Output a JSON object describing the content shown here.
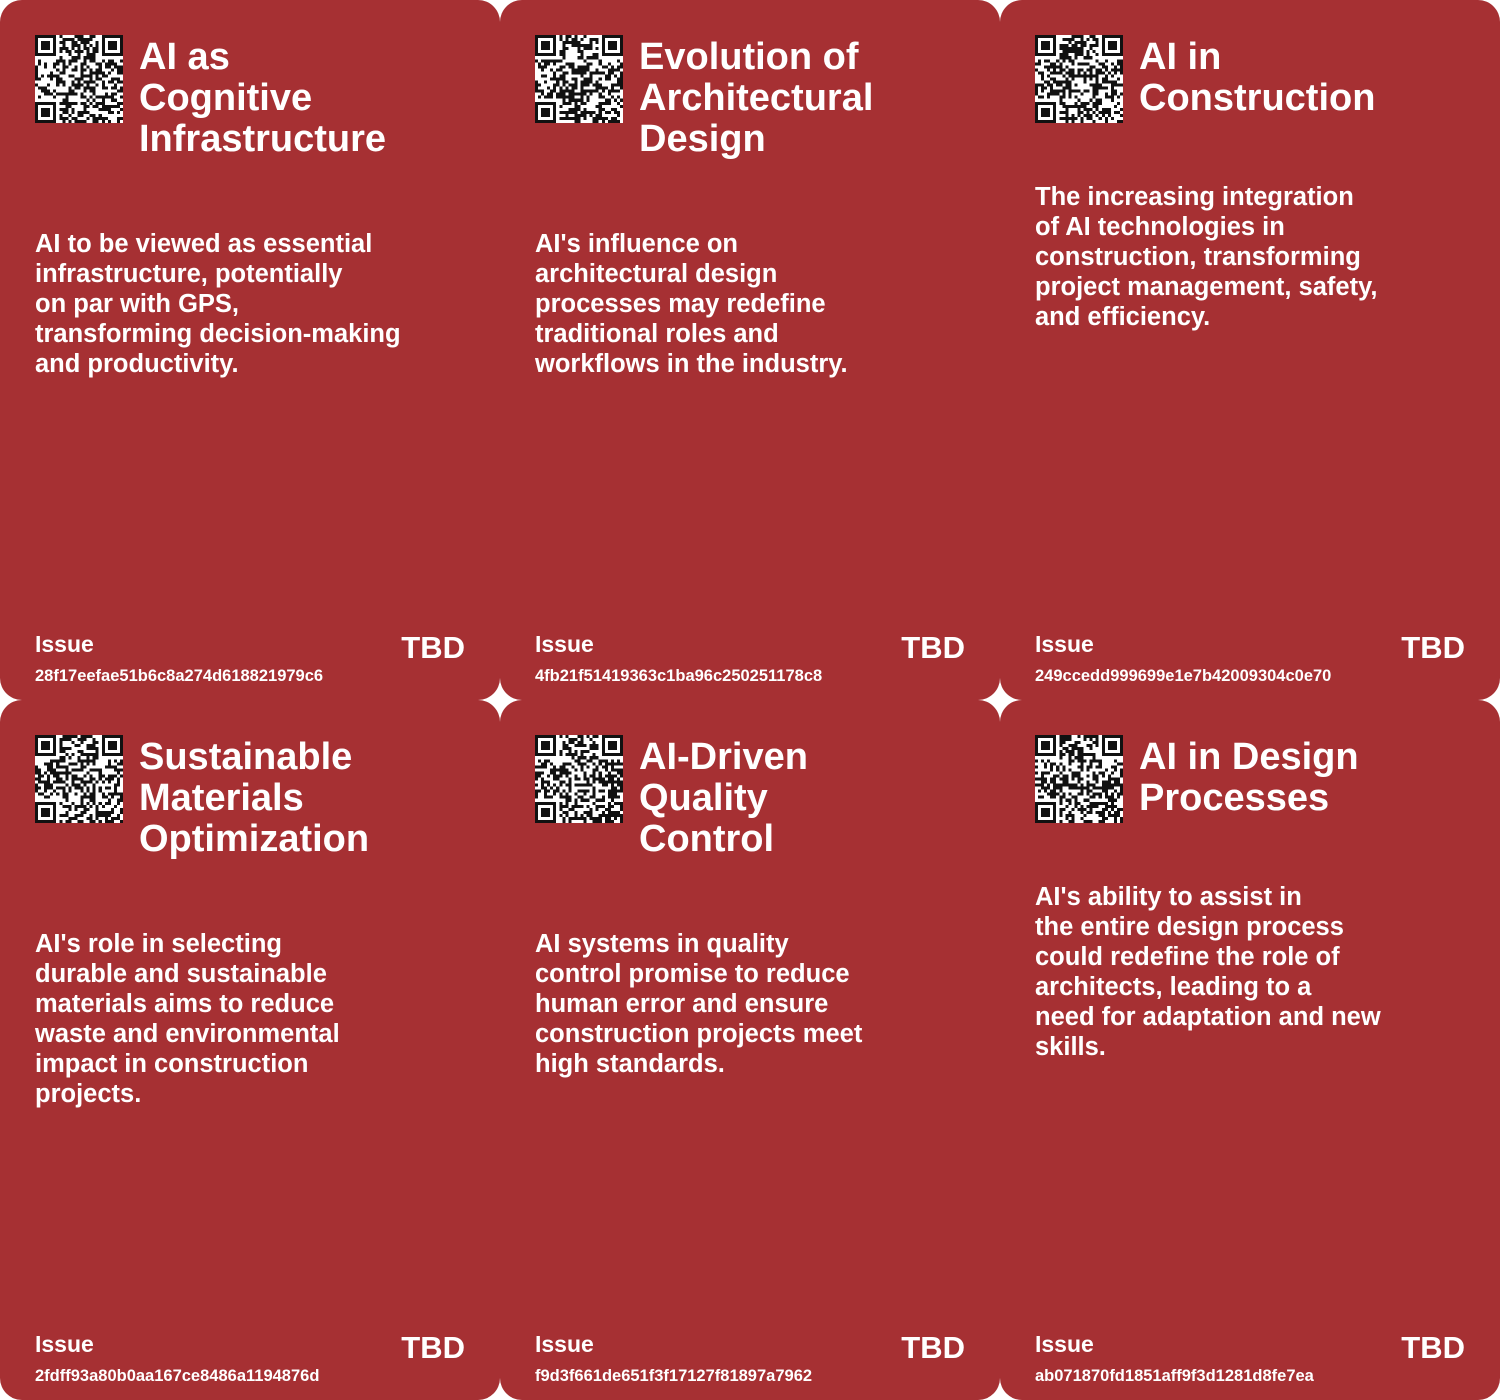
{
  "cards": [
    {
      "title": "AI as\nCognitive\nInfrastructure",
      "description": "AI to be viewed as essential\ninfrastructure, potentially\non par with GPS,\ntransforming decision-making\nand productivity.",
      "issue_label": "Issue",
      "issue_id": "28f17eefae51b6c8a274d618821979c6",
      "status": "TBD",
      "qr_icon": "qr-code-icon"
    },
    {
      "title": "Evolution of\nArchitectural\nDesign",
      "description": "AI's influence on\narchitectural design\nprocesses may redefine\ntraditional roles and\nworkflows in the industry.",
      "issue_label": "Issue",
      "issue_id": "4fb21f51419363c1ba96c250251178c8",
      "status": "TBD",
      "qr_icon": "qr-code-icon"
    },
    {
      "title": "AI in\nConstruction",
      "description": "The increasing integration\nof AI technologies in\nconstruction, transforming\nproject management, safety,\nand efficiency.",
      "issue_label": "Issue",
      "issue_id": "249ccedd999699e1e7b42009304c0e70",
      "status": "TBD",
      "qr_icon": "qr-code-icon"
    },
    {
      "title": "Sustainable\nMaterials\nOptimization",
      "description": "AI's role in selecting\ndurable and sustainable\nmaterials aims to reduce\nwaste and environmental\nimpact in construction\nprojects.",
      "issue_label": "Issue",
      "issue_id": "2fdff93a80b0aa167ce8486a1194876d",
      "status": "TBD",
      "qr_icon": "qr-code-icon"
    },
    {
      "title": "AI-Driven\nQuality\nControl",
      "description": "AI systems in quality\ncontrol promise to reduce\nhuman error and ensure\nconstruction projects meet\nhigh standards.",
      "issue_label": "Issue",
      "issue_id": "f9d3f661de651f3f17127f81897a7962",
      "status": "TBD",
      "qr_icon": "qr-code-icon"
    },
    {
      "title": "AI in Design\nProcesses",
      "description": "AI's ability to assist in\nthe entire design process\ncould redefine the role of\narchitects, leading to a\nneed for adaptation and new\nskills.",
      "issue_label": "Issue",
      "issue_id": "ab071870fd1851aff9f3d1281d8fe7ea",
      "status": "TBD",
      "qr_icon": "qr-code-icon"
    }
  ],
  "colors": {
    "card_background": "#a63033",
    "text": "#ffffff",
    "page_background": "#ffffff"
  }
}
